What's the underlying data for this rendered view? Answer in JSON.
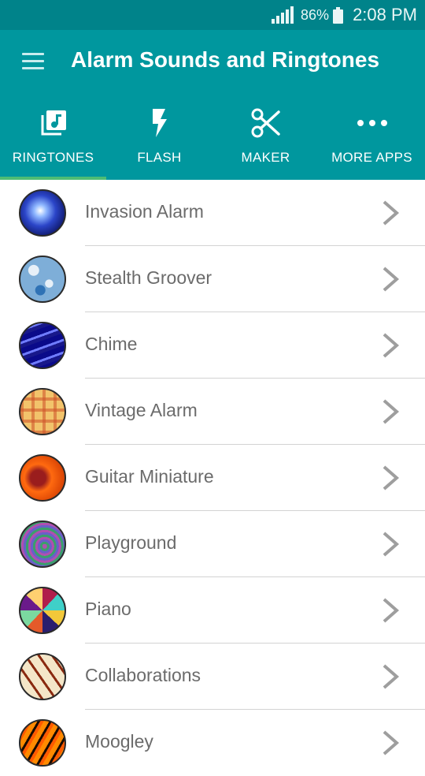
{
  "status_bar": {
    "battery_percent": "86%",
    "time": "2:08 PM"
  },
  "app_bar": {
    "title": "Alarm Sounds and Ringtones"
  },
  "tabs": [
    {
      "label": "RINGTONES",
      "icon": "music-library-icon",
      "selected": true
    },
    {
      "label": "FLASH",
      "icon": "flash-icon",
      "selected": false
    },
    {
      "label": "MAKER",
      "icon": "scissors-icon",
      "selected": false
    },
    {
      "label": "MORE APPS",
      "icon": "more-horizontal-icon",
      "selected": false
    }
  ],
  "ringtones": [
    {
      "name": "Invasion Alarm"
    },
    {
      "name": "Stealth Groover"
    },
    {
      "name": "Chime"
    },
    {
      "name": "Vintage Alarm"
    },
    {
      "name": "Guitar Miniature"
    },
    {
      "name": "Playground"
    },
    {
      "name": "Piano"
    },
    {
      "name": "Collaborations"
    },
    {
      "name": "Moogley"
    }
  ],
  "colors": {
    "status_bar": "#00838a",
    "app_bar": "#00979e",
    "tab_indicator": "#4dbd74",
    "list_text": "#6b6b6b",
    "chevron": "#9e9e9e"
  }
}
